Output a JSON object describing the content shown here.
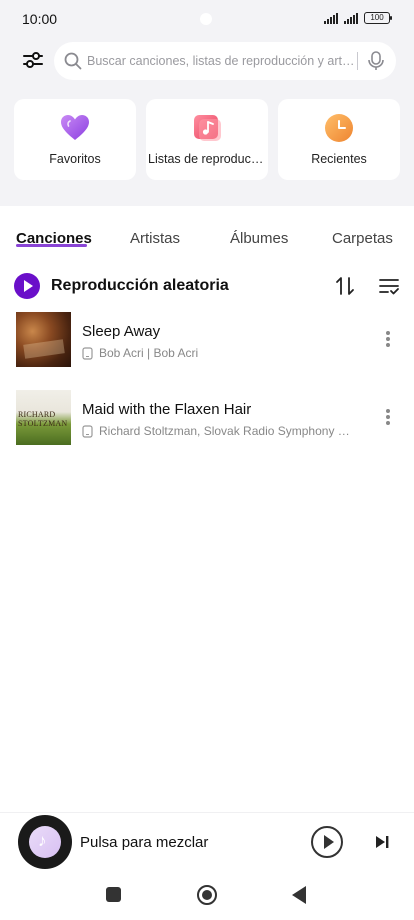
{
  "status_bar": {
    "time": "10:00",
    "battery": "100"
  },
  "search": {
    "placeholder": "Buscar canciones, listas de reproducción y artistas"
  },
  "quick_cards": [
    {
      "label": "Favoritos",
      "icon": "heart-icon",
      "color": "#a05be8"
    },
    {
      "label": "Listas de reproducción",
      "icon": "playlist-icon",
      "color": "#f0566f"
    },
    {
      "label": "Recientes",
      "icon": "clock-icon",
      "color": "#f19a3e"
    }
  ],
  "tabs": [
    "Canciones",
    "Artistas",
    "Álbumes",
    "Carpetas"
  ],
  "active_tab": "Canciones",
  "shuffle": {
    "label": "Reproducción aleatoria"
  },
  "songs": [
    {
      "title": "Sleep Away",
      "subtitle": "Bob Acri | Bob Acri"
    },
    {
      "title": "Maid with the Flaxen Hair",
      "subtitle": "Richard Stoltzman, Slovak Radio Symphony Orchestra",
      "art_text": "RICHARD STOLTZMAN"
    }
  ],
  "mini_player": {
    "label": "Pulsa para mezclar"
  },
  "colors": {
    "accent": "#6a0fc9",
    "tab_underline": "#8a45d6",
    "header_bg": "#f3f3f6"
  }
}
